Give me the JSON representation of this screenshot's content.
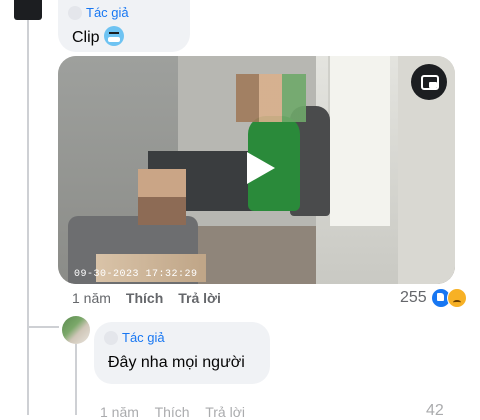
{
  "comment_top": {
    "author_badge": "Tác giả",
    "text": "Clip",
    "emoji": "cold-face-emoji"
  },
  "video": {
    "timestamp": "09-30-2023 17:32:29",
    "play_icon": "play-icon",
    "pip_icon": "picture-in-picture-icon"
  },
  "actions_top": {
    "time": "1 năm",
    "like": "Thích",
    "reply": "Trả lời",
    "reaction_count": "255",
    "reactions": [
      "like-reaction-icon",
      "sad-reaction-icon"
    ]
  },
  "comment_reply": {
    "author_badge": "Tác giả",
    "text": "Đây nha mọi người"
  },
  "actions_reply": {
    "time": "1 năm",
    "like": "Thích",
    "reply": "Trả lời",
    "reaction_count": "42"
  },
  "colors": {
    "bubble": "#f0f2f5",
    "author_badge": "#1877f2",
    "meta_text": "#65676b"
  }
}
